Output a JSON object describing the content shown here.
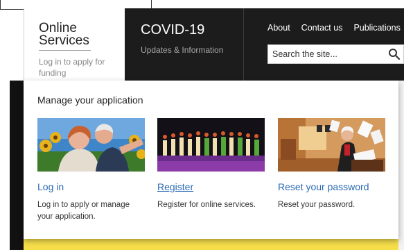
{
  "brand": {
    "title": "Online Services",
    "subtitle": "Log in to apply for funding"
  },
  "covid": {
    "title": "COVID-19",
    "subtitle": "Updates & Information"
  },
  "top_nav": {
    "items": [
      {
        "label": "About"
      },
      {
        "label": "Contact us"
      },
      {
        "label": "Publications"
      }
    ]
  },
  "search": {
    "placeholder": "Search the site...",
    "icon": "search-icon"
  },
  "dropdown": {
    "title": "Manage your application",
    "cards": [
      {
        "link": "Log in",
        "description": "Log in to apply or manage your application.",
        "image": "photo of two smiling older people with sunflowers"
      },
      {
        "link": "Register",
        "description": "Register for online services.",
        "image": "photo of performers on a purple-lit stage"
      },
      {
        "link": "Reset your password",
        "description": "Reset your password.",
        "image": "photo of a man throwing papers in an office"
      }
    ]
  },
  "colors": {
    "header_bg": "#1c1c1c",
    "link": "#2a6bb4",
    "background_accent": "#f7df4a"
  }
}
